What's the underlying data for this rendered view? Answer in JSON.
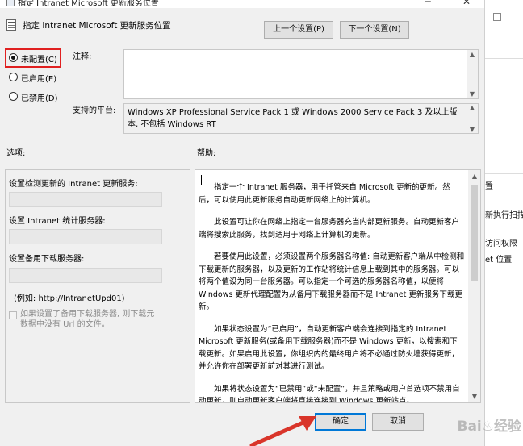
{
  "window": {
    "title": "指定 Intranet Microsoft 更新服务位置",
    "minimize_glyph": "─",
    "close_glyph": "✕"
  },
  "header": {
    "policy_title": "指定 Intranet Microsoft 更新服务位置",
    "prev_button": "上一个设置(P)",
    "next_button": "下一个设置(N)"
  },
  "state": {
    "options": [
      {
        "label": "未配置(C)",
        "selected": true
      },
      {
        "label": "已启用(E)",
        "selected": false
      },
      {
        "label": "已禁用(D)",
        "selected": false
      }
    ]
  },
  "comment": {
    "label": "注释:",
    "value": ""
  },
  "platform": {
    "label": "支持的平台:",
    "line1": "Windows XP Professional Service Pack 1 或 Windows 2000 Service Pack 3 及以上版",
    "line2": "本, 不包括 Windows RT"
  },
  "options_panel": {
    "title": "选项:",
    "detect_label": "设置检测更新的 Intranet 更新服务:",
    "stats_label": "设置 Intranet 统计服务器:",
    "alt_download_label": "设置备用下载服务器:",
    "example": "(例如: http://IntranetUpd01)",
    "checkbox_line1": "如果设置了备用下载服务器, 则下载元",
    "checkbox_line2": "数据中没有 Url 的文件。"
  },
  "help_panel": {
    "title": "帮助:",
    "paragraphs": [
      "指定一个 Intranet 服务器，用于托管来自 Microsoft 更新的更新。然后，可以使用此更新服务自动更新网络上的计算机。",
      "此设置可让你在网络上指定一台服务器充当内部更新服务。自动更新客户端将搜索此服务，找到适用于网络上计算机的更新。",
      "若要使用此设置，必须设置两个服务器名称值: 自动更新客户端从中检测和下载更新的服务器，以及更新的工作站将统计信息上载到其中的服务器。可以将两个值设为同一台服务器。可以指定一个可选的服务器名称值，以便将 Windows 更新代理配置为从备用下载服务器而不是 Intranet 更新服务下载更新。",
      "如果状态设置为“已启用”，自动更新客户端会连接到指定的 Intranet Microsoft 更新服务(或备用下载服务器)而不是 Windows 更新，以搜索和下载更新。如果启用此设置，你组织内的最终用户将不必通过防火墙获得更新，并允许你在部署更新前对其进行测试。",
      "如果将状态设置为“已禁用”或“未配置”，并且策略或用户首选项不禁用自动更新，则自动更新客户端将直接连接到 Windows 更新站点。"
    ]
  },
  "footer": {
    "ok": "确定",
    "cancel": "取消"
  },
  "background_window": {
    "items": [
      "置",
      "新执行扫描",
      "访问权限",
      "et 位置"
    ]
  },
  "watermark": "Bai♨经验",
  "colors": {
    "highlight_red": "#e02020",
    "arrow_red": "#d9352a",
    "accent": "#0078d7"
  }
}
